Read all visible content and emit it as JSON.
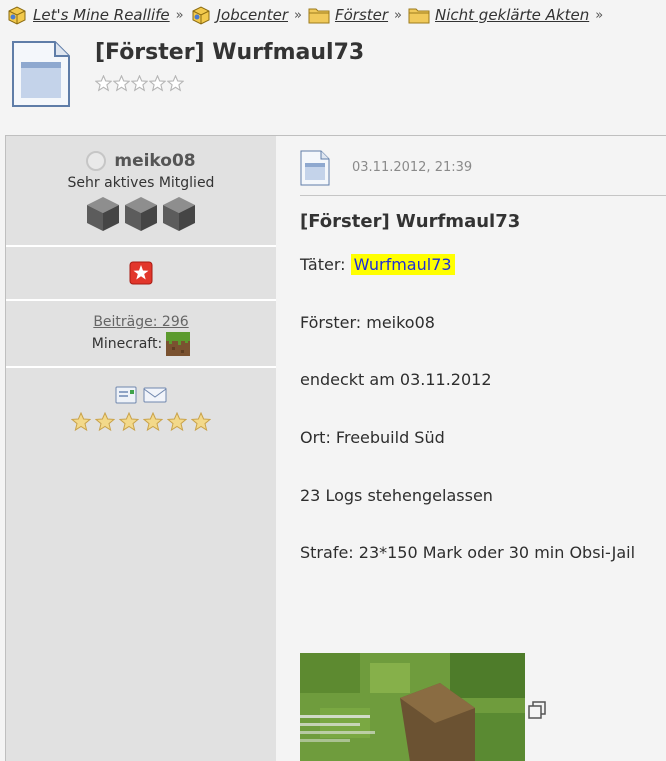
{
  "breadcrumb": [
    {
      "label": "Let's Mine Reallife",
      "icon": "board-icon"
    },
    {
      "label": "Jobcenter",
      "icon": "board-icon"
    },
    {
      "label": "Förster",
      "icon": "folder-icon"
    },
    {
      "label": "Nicht geklärte Akten",
      "icon": "folder-icon"
    }
  ],
  "breadcrumb_separator": "»",
  "thread": {
    "title": "[Förster] Wurfmaul73",
    "rating_stars": 5
  },
  "author": {
    "username": "meiko08",
    "rank": "Sehr aktives Mitglied",
    "posts_label": "Beiträge: 296",
    "minecraft_label": "Minecraft:"
  },
  "post": {
    "date": "03.11.2012, 21:39",
    "title": "[Förster] Wurfmaul73",
    "taeter_label": "Täter:",
    "taeter_name": "Wurfmaul73",
    "lines": [
      "Förster: meiko08",
      "endeckt am 03.11.2012",
      "Ort: Freebuild Süd",
      "23 Logs stehengelassen",
      "Strafe: 23*150 Mark oder 30 min Obsi-Jail"
    ]
  },
  "colors": {
    "highlight": "#ffff00",
    "link": "#1f2fd6",
    "sidebar": "#e1e1e1"
  }
}
